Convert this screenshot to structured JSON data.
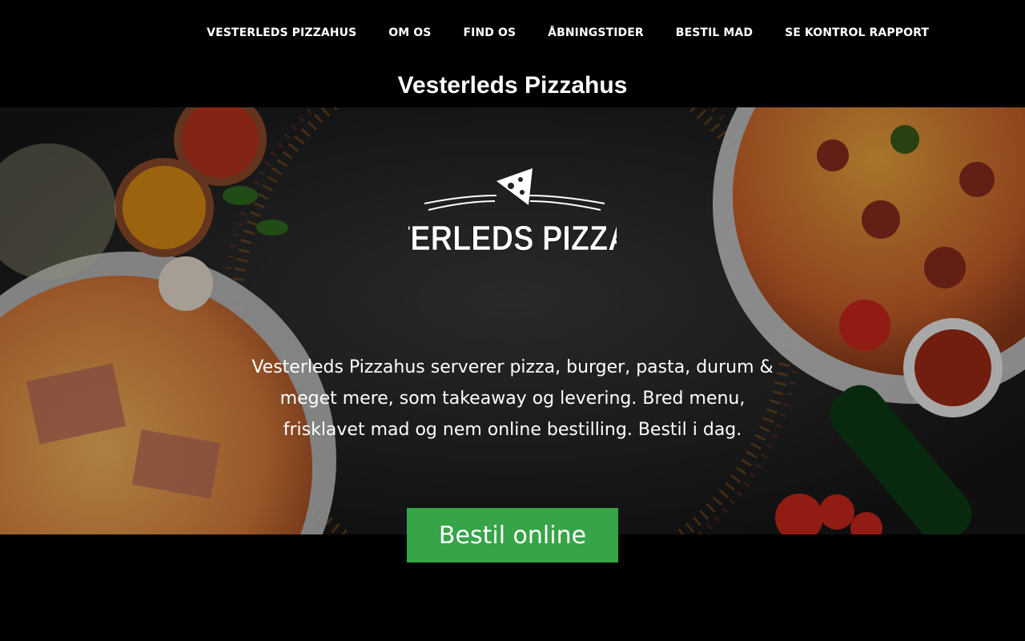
{
  "nav": {
    "items": [
      {
        "label": "VESTERLEDS PIZZAHUS"
      },
      {
        "label": "OM OS"
      },
      {
        "label": "FIND OS"
      },
      {
        "label": "ÅBNINGSTIDER"
      },
      {
        "label": "BESTIL MAD"
      },
      {
        "label": "SE KONTROL RAPPORT"
      }
    ]
  },
  "header": {
    "title": "Vesterleds Pizzahus"
  },
  "hero": {
    "logo_text": "VESTERLEDS PIZZAHUS",
    "description": "Vesterleds Pizzahus serverer pizza, burger, pasta, durum & meget mere, som takeaway og levering. Bred menu, frisklavet mad og nem online bestilling. Bestil i dag."
  },
  "cta": {
    "label": "Bestil online"
  },
  "colors": {
    "cta": "#36a447",
    "background": "#000000"
  },
  "icons": [
    "pizza-slice-icon"
  ]
}
